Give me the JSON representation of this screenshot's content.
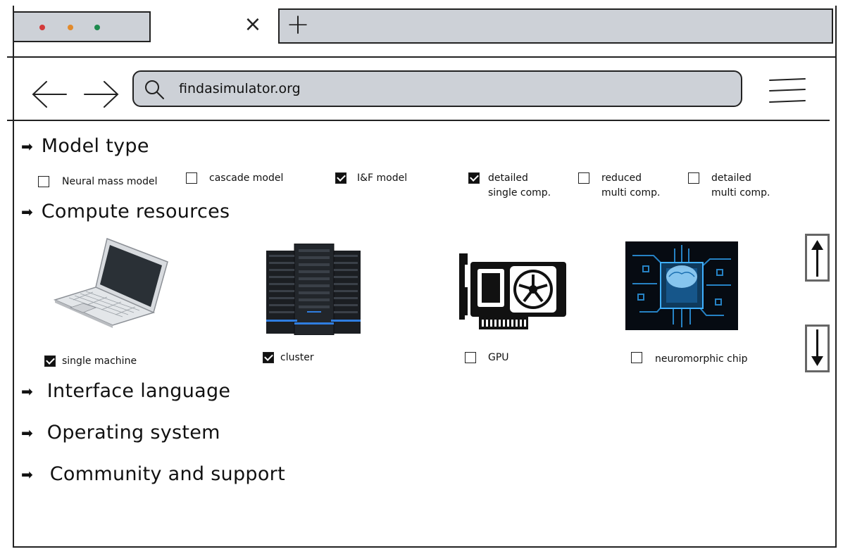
{
  "browser": {
    "tab_controls": [
      "close-dot-red",
      "minimize-dot-orange",
      "maximize-dot-green"
    ],
    "tab_close_glyph": "×",
    "new_tab_glyph": "+",
    "url": "findasimulator.org",
    "colors": {
      "chrome_fill": "#cdd1d7",
      "dot_red": "#d33a3a",
      "dot_orange": "#e28a2b",
      "dot_green": "#1e8a4e"
    }
  },
  "sections": {
    "model_type": {
      "title": "Model type",
      "options": [
        {
          "label": "Neural mass model",
          "checked": false
        },
        {
          "label": "cascade model",
          "checked": false
        },
        {
          "label": "I&F model",
          "checked": true
        },
        {
          "label": "detailed\nsingle comp.",
          "checked": true
        },
        {
          "label": "reduced\nmulti comp.",
          "checked": false
        },
        {
          "label": "detailed\nmulti comp.",
          "checked": false
        }
      ]
    },
    "compute_resources": {
      "title": "Compute resources",
      "options": [
        {
          "label": "single machine",
          "checked": true,
          "icon": "laptop-icon"
        },
        {
          "label": "cluster",
          "checked": true,
          "icon": "server-rack-icon"
        },
        {
          "label": "GPU",
          "checked": false,
          "icon": "gpu-card-icon"
        },
        {
          "label": "neuromorphic chip",
          "checked": false,
          "icon": "neuromorphic-chip-icon"
        }
      ]
    },
    "interface_language": {
      "title": "Interface language"
    },
    "operating_system": {
      "title": "Operating system"
    },
    "community_support": {
      "title": "Community and support"
    }
  },
  "arrow_glyph": "➡",
  "scroll": {
    "up_icon": "arrow-up-icon",
    "down_icon": "arrow-down-icon"
  }
}
